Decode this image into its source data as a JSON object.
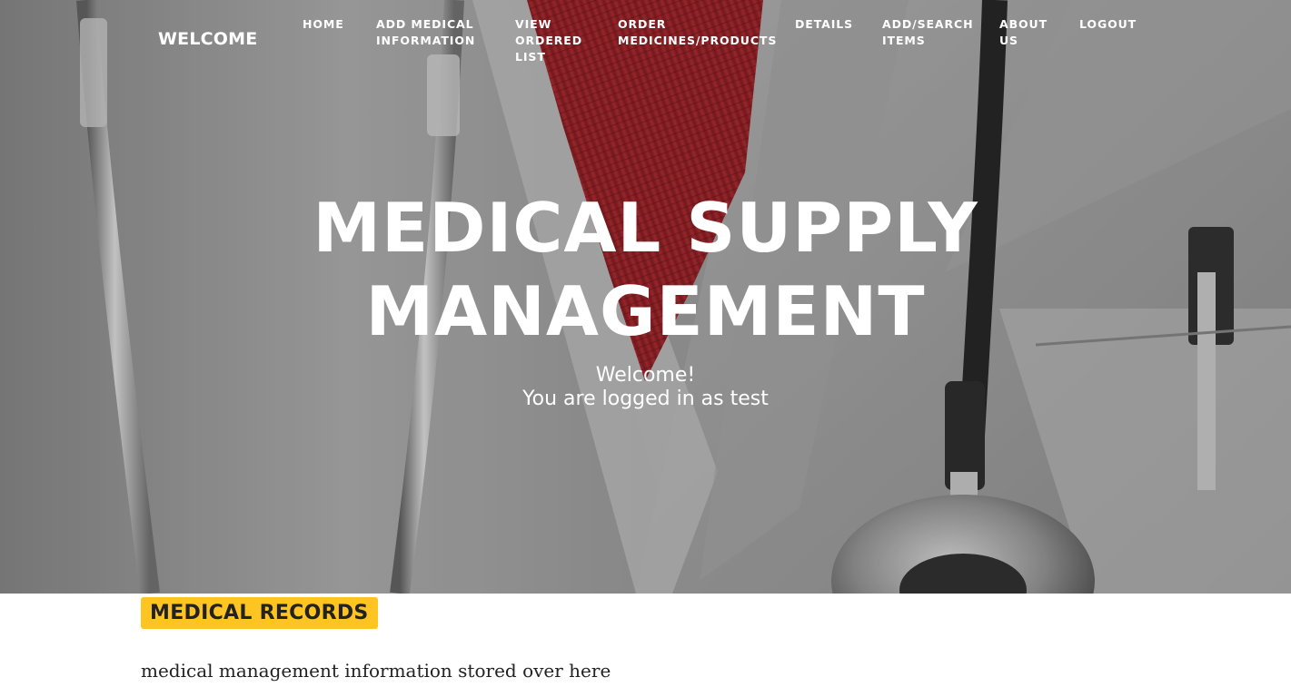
{
  "navbar": {
    "brand": "WELCOME",
    "items": [
      {
        "line1": "HOME",
        "line2": "",
        "line3": ""
      },
      {
        "line1": "ADD MEDICAL",
        "line2": "INFORMATION",
        "line3": ""
      },
      {
        "line1": "VIEW",
        "line2": "ORDERED",
        "line3": "LIST"
      },
      {
        "line1": "ORDER",
        "line2": "MEDICINES/PRODUCTS",
        "line3": ""
      },
      {
        "line1": "DETAILS",
        "line2": "",
        "line3": ""
      },
      {
        "line1": "ADD/SEARCH",
        "line2": "ITEMS",
        "line3": ""
      },
      {
        "line1": "ABOUT",
        "line2": "US",
        "line3": ""
      },
      {
        "line1": "LOGOUT",
        "line2": "",
        "line3": ""
      }
    ]
  },
  "hero": {
    "title_line1": "MEDICAL SUPPLY",
    "title_line2": "MANAGEMENT",
    "welcome": "Welcome!",
    "logged_in": "You are logged in as test",
    "background_image": "doctor-coat-stethoscope-photo"
  },
  "section": {
    "badge": "MEDICAL RECORDS",
    "text": "medical management information stored over here"
  },
  "colors": {
    "badge_bg": "#fec421",
    "nav_text": "#ffffff",
    "body_text": "#222222",
    "tie_red": "#9b1c22"
  }
}
